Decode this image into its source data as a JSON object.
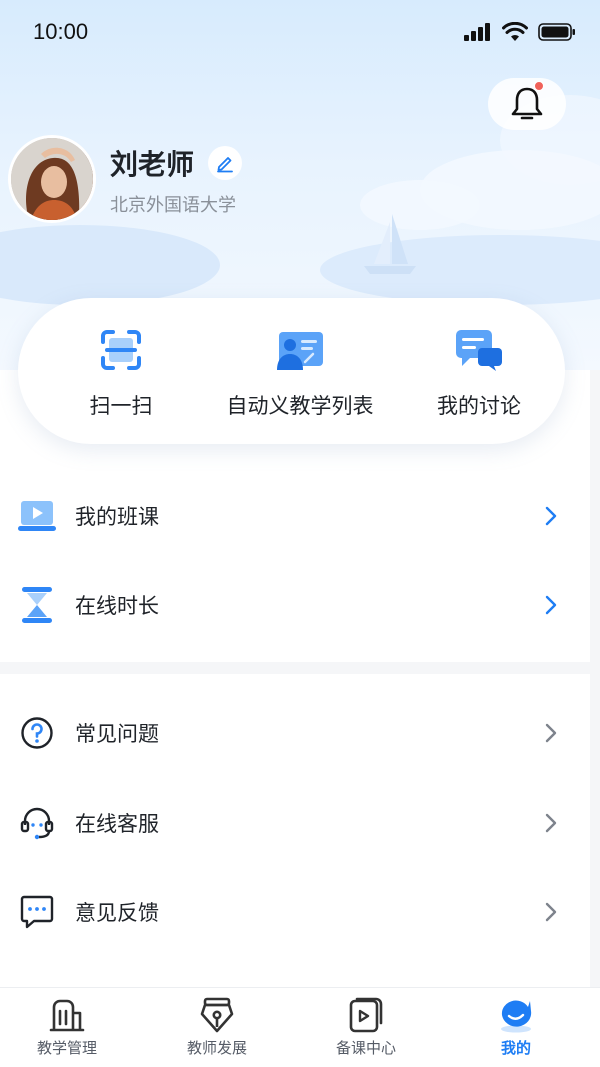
{
  "status_bar": {
    "time": "10:00",
    "icons": [
      "signal-icon",
      "wifi-icon",
      "battery-icon"
    ]
  },
  "header": {
    "notification_icon": "bell-icon",
    "has_unread": true
  },
  "profile": {
    "name": "刘老师",
    "school": "北京外国语大学",
    "edit_icon": "pencil-icon"
  },
  "quick_actions": [
    {
      "label": "扫一扫",
      "icon": "scan-icon"
    },
    {
      "label": "自动义教学列表",
      "icon": "teaching-list-icon"
    },
    {
      "label": "我的讨论",
      "icon": "discussion-icon"
    }
  ],
  "menu_group_1": [
    {
      "label": "我的班课",
      "icon": "class-video-icon"
    },
    {
      "label": "在线时长",
      "icon": "hourglass-icon"
    }
  ],
  "menu_group_2": [
    {
      "label": "常见问题",
      "icon": "question-icon"
    },
    {
      "label": "在线客服",
      "icon": "headset-icon"
    },
    {
      "label": "意见反馈",
      "icon": "feedback-icon"
    }
  ],
  "tabs": [
    {
      "label": "教学管理",
      "icon": "building-icon",
      "active": false
    },
    {
      "label": "教师发展",
      "icon": "pen-nib-icon",
      "active": false
    },
    {
      "label": "备课中心",
      "icon": "play-doc-icon",
      "active": false
    },
    {
      "label": "我的",
      "icon": "profile-face-icon",
      "active": true
    }
  ],
  "colors": {
    "accent": "#1e7df4",
    "badge": "#f0625a",
    "text_primary": "#1f2329",
    "text_secondary": "#8a9099"
  }
}
